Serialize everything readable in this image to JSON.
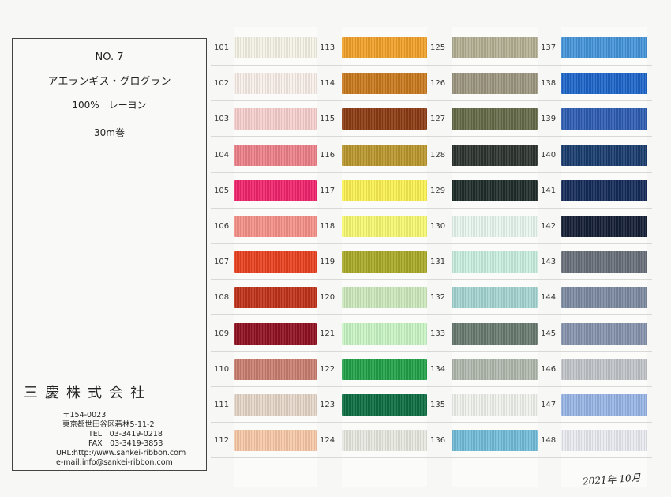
{
  "card": {
    "number": "NO. 7",
    "product_name": "アエランギス・グログラン",
    "material": "100%　レーヨン",
    "length": "30m巻",
    "company": "三慶株式会社",
    "postal": "〒154-0023",
    "address": "東京都世田谷区若林5-11-2",
    "tel": "TEL　03-3419-0218",
    "fax": "FAX　03-3419-3853",
    "url": "URL:http://www.sankei-ribbon.com",
    "email": "e-mail:info@sankei-ribbon.com"
  },
  "signature": "2021年 10月",
  "columns": [
    {
      "items": [
        {
          "code": "101",
          "color": "#f5f2e6"
        },
        {
          "code": "102",
          "color": "#f8efe9"
        },
        {
          "code": "103",
          "color": "#f6cfcd"
        },
        {
          "code": "104",
          "color": "#ec8088"
        },
        {
          "code": "105",
          "color": "#f0246c"
        },
        {
          "code": "106",
          "color": "#f49088"
        },
        {
          "code": "107",
          "color": "#e8401e"
        },
        {
          "code": "108",
          "color": "#bf3219"
        },
        {
          "code": "109",
          "color": "#8f1020"
        },
        {
          "code": "110",
          "color": "#c87e70"
        },
        {
          "code": "111",
          "color": "#e4d6c8"
        },
        {
          "code": "112",
          "color": "#f7c8a8"
        }
      ]
    },
    {
      "items": [
        {
          "code": "113",
          "color": "#f0a028"
        },
        {
          "code": "114",
          "color": "#c7781c"
        },
        {
          "code": "115",
          "color": "#8a3a12"
        },
        {
          "code": "116",
          "color": "#b8962c"
        },
        {
          "code": "117",
          "color": "#fbf050"
        },
        {
          "code": "118",
          "color": "#f5f870"
        },
        {
          "code": "119",
          "color": "#a8a828"
        },
        {
          "code": "120",
          "color": "#cce8bc"
        },
        {
          "code": "121",
          "color": "#c8f4c4"
        },
        {
          "code": "122",
          "color": "#20a048"
        },
        {
          "code": "123",
          "color": "#0c6c40"
        },
        {
          "code": "124",
          "color": "#e6e8e0"
        }
      ]
    },
    {
      "items": [
        {
          "code": "125",
          "color": "#b4b094"
        },
        {
          "code": "126",
          "color": "#9c9680"
        },
        {
          "code": "127",
          "color": "#646a48"
        },
        {
          "code": "128",
          "color": "#2c3430"
        },
        {
          "code": "129",
          "color": "#1e2c2a"
        },
        {
          "code": "130",
          "color": "#e8f6ee"
        },
        {
          "code": "131",
          "color": "#c8eee0"
        },
        {
          "code": "132",
          "color": "#a4d4d0"
        },
        {
          "code": "133",
          "color": "#687a70"
        },
        {
          "code": "134",
          "color": "#b0b8ae"
        },
        {
          "code": "135",
          "color": "#eff2ec"
        },
        {
          "code": "136",
          "color": "#72bcd8"
        }
      ]
    },
    {
      "items": [
        {
          "code": "137",
          "color": "#4494d8"
        },
        {
          "code": "138",
          "color": "#1c64c8"
        },
        {
          "code": "139",
          "color": "#2c5cb0"
        },
        {
          "code": "140",
          "color": "#183c6c"
        },
        {
          "code": "141",
          "color": "#142a58"
        },
        {
          "code": "142",
          "color": "#141e34"
        },
        {
          "code": "143",
          "color": "#686e78"
        },
        {
          "code": "144",
          "color": "#7c8aa0"
        },
        {
          "code": "145",
          "color": "#8492ac"
        },
        {
          "code": "146",
          "color": "#c0c4c8"
        },
        {
          "code": "147",
          "color": "#98b4e6"
        },
        {
          "code": "148",
          "color": "#e8eaf0"
        }
      ]
    }
  ]
}
